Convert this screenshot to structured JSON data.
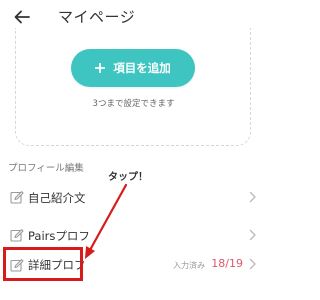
{
  "header": {
    "title": "マイページ",
    "back_icon": "arrow-left-icon"
  },
  "settings_card": {
    "add_button_label": "項目を追加",
    "add_icon": "plus-icon",
    "limit_note": "3つまで設定できます"
  },
  "profile_section": {
    "title": "プロフィール編集",
    "items": [
      {
        "label": "自己紹介文",
        "icon": "edit-icon"
      },
      {
        "label": "Pairsプロフ",
        "icon": "edit-icon"
      },
      {
        "label": "詳細プロフ",
        "icon": "edit-icon",
        "status": "入力済み",
        "progress": "18/19"
      }
    ]
  },
  "annotation": {
    "text": "タップ！",
    "color": "#d81a1a"
  },
  "colors": {
    "accent": "#3ec5c1",
    "progress": "#e0566a",
    "highlight": "#d81a1a"
  }
}
